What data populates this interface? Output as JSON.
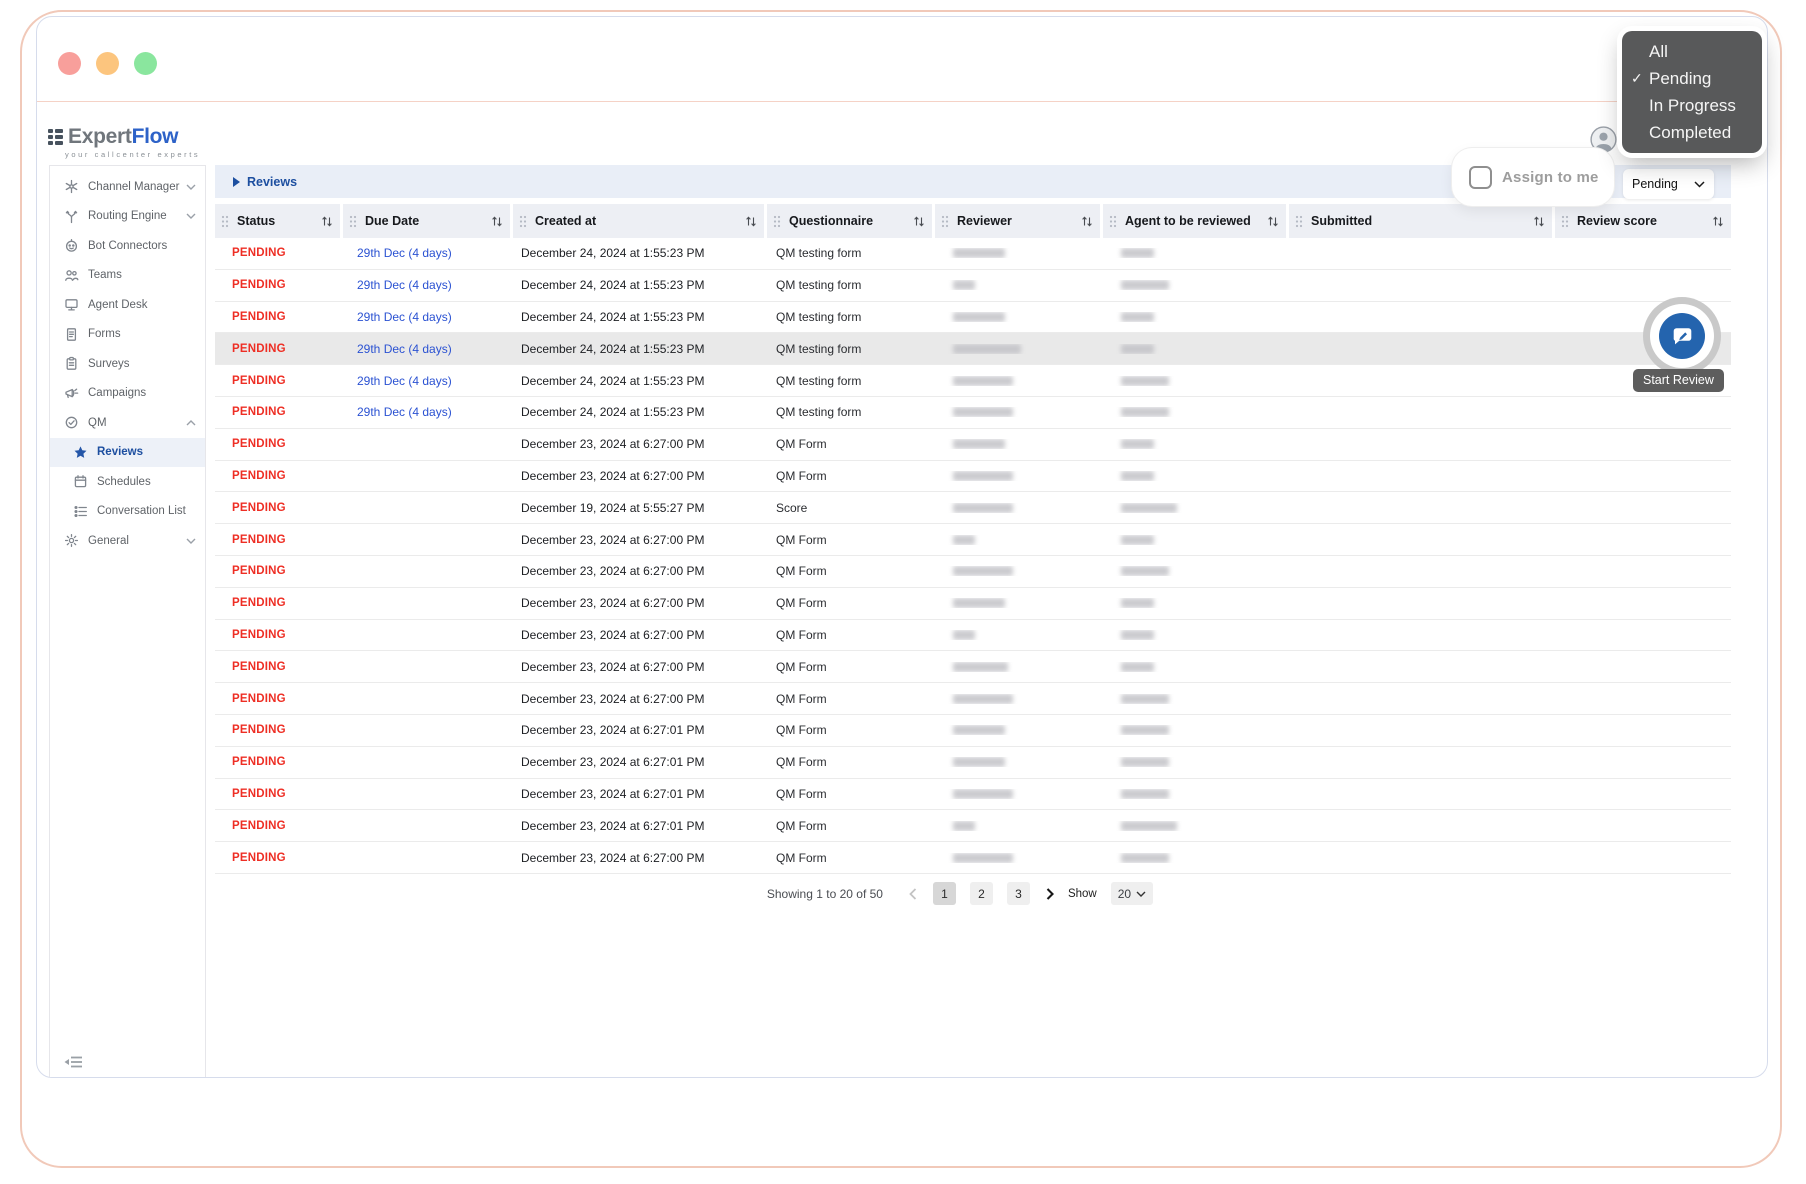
{
  "chrome": {
    "traffic_lights": [
      "#f89f9b",
      "#fcc57e",
      "#8ae69e"
    ]
  },
  "brand": {
    "name_primary": "Expert",
    "name_accent": "Flow",
    "tagline": "your callcenter experts"
  },
  "header": {
    "avatar_icon": "user-avatar-icon"
  },
  "sidebar": {
    "items": [
      {
        "label": "Channel Manager",
        "icon": "channel-manager-icon",
        "expandable": true,
        "expanded": false
      },
      {
        "label": "Routing Engine",
        "icon": "routing-engine-icon",
        "expandable": true,
        "expanded": false
      },
      {
        "label": "Bot Connectors",
        "icon": "bot-connectors-icon"
      },
      {
        "label": "Teams",
        "icon": "teams-icon"
      },
      {
        "label": "Agent Desk",
        "icon": "agent-desk-icon"
      },
      {
        "label": "Forms",
        "icon": "forms-icon"
      },
      {
        "label": "Surveys",
        "icon": "surveys-icon"
      },
      {
        "label": "Campaigns",
        "icon": "campaigns-icon"
      },
      {
        "label": "QM",
        "icon": "qm-icon",
        "expandable": true,
        "expanded": true
      },
      {
        "label": "Reviews",
        "icon": "reviews-star-icon",
        "child": true,
        "active": true
      },
      {
        "label": "Schedules",
        "icon": "schedules-icon",
        "child": true
      },
      {
        "label": "Conversation List",
        "icon": "conversation-list-icon",
        "child": true
      },
      {
        "label": "General",
        "icon": "general-gear-icon",
        "expandable": true,
        "expanded": false
      }
    ],
    "collapse_icon": "collapse-sidebar-icon"
  },
  "toolbar": {
    "breadcrumb": "Reviews",
    "assign_checkbox_label": "Assign to me",
    "assign_checkbox_checked": false,
    "status_filter": {
      "value": "Pending"
    }
  },
  "status_menu": {
    "items": [
      {
        "label": "All",
        "selected": false
      },
      {
        "label": "Pending",
        "selected": true
      },
      {
        "label": "In Progress",
        "selected": false
      },
      {
        "label": "Completed",
        "selected": false
      }
    ]
  },
  "table": {
    "columns": [
      {
        "label": "Status",
        "sortable": true
      },
      {
        "label": "Due Date",
        "sortable": true
      },
      {
        "label": "Created at",
        "sortable": true
      },
      {
        "label": "Questionnaire",
        "sortable": true
      },
      {
        "label": "Reviewer",
        "sortable": true
      },
      {
        "label": "Agent to be reviewed",
        "sortable": true
      },
      {
        "label": "Submitted",
        "sortable": true
      },
      {
        "label": "Review score",
        "sortable": true
      }
    ],
    "rows": [
      {
        "status": "PENDING",
        "due_date": "29th Dec (4 days)",
        "created_at": "December 24, 2024 at 1:55:23 PM",
        "questionnaire": "QM testing form",
        "reviewer_redacted": true,
        "reviewer_w": 52,
        "agent_redacted": true,
        "agent_w": 33,
        "submitted": "",
        "review_score": "",
        "highlighted": false
      },
      {
        "status": "PENDING",
        "due_date": "29th Dec (4 days)",
        "created_at": "December 24, 2024 at 1:55:23 PM",
        "questionnaire": "QM testing form",
        "reviewer_redacted": true,
        "reviewer_w": 22,
        "agent_redacted": true,
        "agent_w": 48,
        "submitted": "",
        "review_score": "",
        "highlighted": false
      },
      {
        "status": "PENDING",
        "due_date": "29th Dec (4 days)",
        "created_at": "December 24, 2024 at 1:55:23 PM",
        "questionnaire": "QM testing form",
        "reviewer_redacted": true,
        "reviewer_w": 52,
        "agent_redacted": true,
        "agent_w": 33,
        "submitted": "",
        "review_score": "",
        "highlighted": false
      },
      {
        "status": "PENDING",
        "due_date": "29th Dec (4 days)",
        "created_at": "December 24, 2024 at 1:55:23 PM",
        "questionnaire": "QM testing form",
        "reviewer_redacted": true,
        "reviewer_w": 68,
        "agent_redacted": true,
        "agent_w": 33,
        "submitted": "",
        "review_score": "",
        "highlighted": true
      },
      {
        "status": "PENDING",
        "due_date": "29th Dec (4 days)",
        "created_at": "December 24, 2024 at 1:55:23 PM",
        "questionnaire": "QM testing form",
        "reviewer_redacted": true,
        "reviewer_w": 60,
        "agent_redacted": true,
        "agent_w": 48,
        "submitted": "",
        "review_score": "",
        "highlighted": false
      },
      {
        "status": "PENDING",
        "due_date": "29th Dec (4 days)",
        "created_at": "December 24, 2024 at 1:55:23 PM",
        "questionnaire": "QM testing form",
        "reviewer_redacted": true,
        "reviewer_w": 60,
        "agent_redacted": true,
        "agent_w": 48,
        "submitted": "",
        "review_score": "",
        "highlighted": false
      },
      {
        "status": "PENDING",
        "due_date": "",
        "created_at": "December 23, 2024 at 6:27:00 PM",
        "questionnaire": "QM Form",
        "reviewer_redacted": true,
        "reviewer_w": 52,
        "agent_redacted": true,
        "agent_w": 33,
        "submitted": "",
        "review_score": "",
        "highlighted": false
      },
      {
        "status": "PENDING",
        "due_date": "",
        "created_at": "December 23, 2024 at 6:27:00 PM",
        "questionnaire": "QM Form",
        "reviewer_redacted": true,
        "reviewer_w": 60,
        "agent_redacted": true,
        "agent_w": 33,
        "submitted": "",
        "review_score": "",
        "highlighted": false
      },
      {
        "status": "PENDING",
        "due_date": "",
        "created_at": "December 19, 2024 at 5:55:27 PM",
        "questionnaire": "Score",
        "reviewer_redacted": true,
        "reviewer_w": 60,
        "agent_redacted": true,
        "agent_w": 56,
        "submitted": "",
        "review_score": "",
        "highlighted": false
      },
      {
        "status": "PENDING",
        "due_date": "",
        "created_at": "December 23, 2024 at 6:27:00 PM",
        "questionnaire": "QM Form",
        "reviewer_redacted": true,
        "reviewer_w": 22,
        "agent_redacted": true,
        "agent_w": 33,
        "submitted": "",
        "review_score": "",
        "highlighted": false
      },
      {
        "status": "PENDING",
        "due_date": "",
        "created_at": "December 23, 2024 at 6:27:00 PM",
        "questionnaire": "QM Form",
        "reviewer_redacted": true,
        "reviewer_w": 60,
        "agent_redacted": true,
        "agent_w": 48,
        "submitted": "",
        "review_score": "",
        "highlighted": false
      },
      {
        "status": "PENDING",
        "due_date": "",
        "created_at": "December 23, 2024 at 6:27:00 PM",
        "questionnaire": "QM Form",
        "reviewer_redacted": true,
        "reviewer_w": 52,
        "agent_redacted": true,
        "agent_w": 33,
        "submitted": "",
        "review_score": "",
        "highlighted": false
      },
      {
        "status": "PENDING",
        "due_date": "",
        "created_at": "December 23, 2024 at 6:27:00 PM",
        "questionnaire": "QM Form",
        "reviewer_redacted": true,
        "reviewer_w": 22,
        "agent_redacted": true,
        "agent_w": 33,
        "submitted": "",
        "review_score": "",
        "highlighted": false
      },
      {
        "status": "PENDING",
        "due_date": "",
        "created_at": "December 23, 2024 at 6:27:00 PM",
        "questionnaire": "QM Form",
        "reviewer_redacted": true,
        "reviewer_w": 55,
        "agent_redacted": true,
        "agent_w": 33,
        "submitted": "",
        "review_score": "",
        "highlighted": false
      },
      {
        "status": "PENDING",
        "due_date": "",
        "created_at": "December 23, 2024 at 6:27:00 PM",
        "questionnaire": "QM Form",
        "reviewer_redacted": true,
        "reviewer_w": 60,
        "agent_redacted": true,
        "agent_w": 48,
        "submitted": "",
        "review_score": "",
        "highlighted": false
      },
      {
        "status": "PENDING",
        "due_date": "",
        "created_at": "December 23, 2024 at 6:27:01 PM",
        "questionnaire": "QM Form",
        "reviewer_redacted": true,
        "reviewer_w": 52,
        "agent_redacted": true,
        "agent_w": 48,
        "submitted": "",
        "review_score": "",
        "highlighted": false
      },
      {
        "status": "PENDING",
        "due_date": "",
        "created_at": "December 23, 2024 at 6:27:01 PM",
        "questionnaire": "QM Form",
        "reviewer_redacted": true,
        "reviewer_w": 52,
        "agent_redacted": true,
        "agent_w": 48,
        "submitted": "",
        "review_score": "",
        "highlighted": false
      },
      {
        "status": "PENDING",
        "due_date": "",
        "created_at": "December 23, 2024 at 6:27:01 PM",
        "questionnaire": "QM Form",
        "reviewer_redacted": true,
        "reviewer_w": 60,
        "agent_redacted": true,
        "agent_w": 48,
        "submitted": "",
        "review_score": "",
        "highlighted": false
      },
      {
        "status": "PENDING",
        "due_date": "",
        "created_at": "December 23, 2024 at 6:27:01 PM",
        "questionnaire": "QM Form",
        "reviewer_redacted": true,
        "reviewer_w": 22,
        "agent_redacted": true,
        "agent_w": 56,
        "submitted": "",
        "review_score": "",
        "highlighted": false
      },
      {
        "status": "PENDING",
        "due_date": "",
        "created_at": "December 23, 2024 at 6:27:00 PM",
        "questionnaire": "QM Form",
        "reviewer_redacted": true,
        "reviewer_w": 60,
        "agent_redacted": true,
        "agent_w": 48,
        "submitted": "",
        "review_score": "",
        "highlighted": false
      }
    ]
  },
  "fab": {
    "tooltip": "Start Review",
    "icon": "start-review-icon"
  },
  "pagination": {
    "summary": "Showing 1 to 20 of 50",
    "pages": [
      "1",
      "2",
      "3"
    ],
    "active_page": "1",
    "show_label": "Show",
    "page_size": "20"
  },
  "colors": {
    "pending_red": "#ee2e24",
    "due_link_blue": "#2b52d2",
    "accent_blue": "#1d4fa0",
    "fab_blue": "#2464ae",
    "toolbar_bg": "#e9eef7",
    "header_bg": "#edeff4"
  }
}
